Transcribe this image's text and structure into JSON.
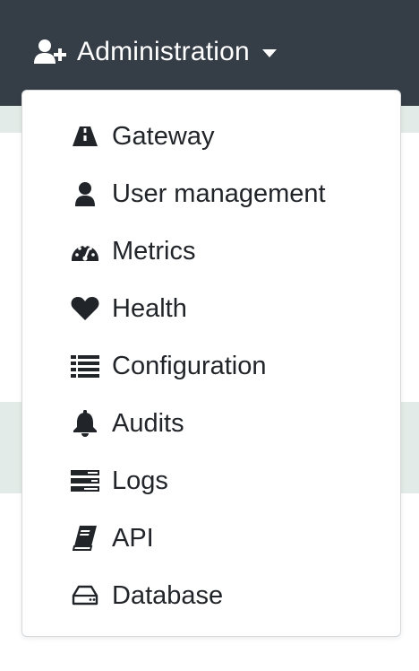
{
  "navbar": {
    "toggle_label": "Administration",
    "toggle_icon": "user-plus-icon",
    "background": "#353d47"
  },
  "menu": {
    "items": [
      {
        "label": "Gateway",
        "icon": "road-icon"
      },
      {
        "label": "User management",
        "icon": "user-icon"
      },
      {
        "label": "Metrics",
        "icon": "tachometer-icon"
      },
      {
        "label": "Health",
        "icon": "heart-icon"
      },
      {
        "label": "Configuration",
        "icon": "list-icon"
      },
      {
        "label": "Audits",
        "icon": "bell-icon"
      },
      {
        "label": "Logs",
        "icon": "tasks-icon"
      },
      {
        "label": "API",
        "icon": "book-icon"
      },
      {
        "label": "Database",
        "icon": "hdd-icon"
      }
    ]
  },
  "colors": {
    "text": "#212529",
    "band": "#e3ebe8"
  }
}
